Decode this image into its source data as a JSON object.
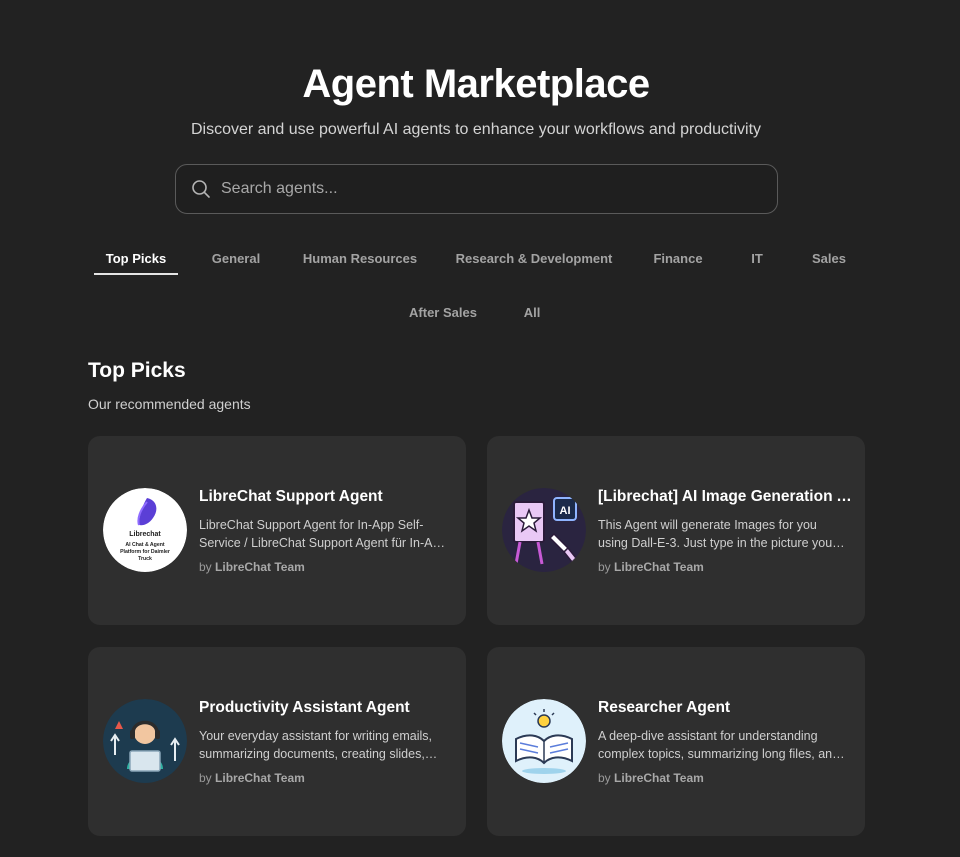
{
  "header": {
    "title": "Agent Marketplace",
    "subtitle": "Discover and use powerful AI agents to enhance your workflows and productivity"
  },
  "search": {
    "placeholder": "Search agents...",
    "value": ""
  },
  "tabs": [
    {
      "label": "Top Picks",
      "active": true
    },
    {
      "label": "General"
    },
    {
      "label": "Human Resources"
    },
    {
      "label": "Research & Development"
    },
    {
      "label": "Finance"
    },
    {
      "label": "IT"
    },
    {
      "label": "Sales"
    },
    {
      "label": "After Sales"
    },
    {
      "label": "All"
    }
  ],
  "section": {
    "title": "Top Picks",
    "subtitle": "Our recommended agents"
  },
  "agents": [
    {
      "name": "LibreChat Support Agent",
      "description": "LibreChat Support Agent for In-App Self-Service / LibreChat Support Agent für In-App Self-Service",
      "by_prefix": "by",
      "author": "LibreChat Team",
      "avatar_icon": "librechat-logo-icon",
      "avatar_text": [
        "Librechat",
        "AI Chat & Agent",
        "Platform for Daimler",
        "Truck"
      ]
    },
    {
      "name": "[Librechat] AI Image Generation Agent",
      "description": "This Agent will generate Images for you using Dall-E-3. Just type in the picture you want to see.",
      "by_prefix": "by",
      "author": "LibreChat Team",
      "avatar_icon": "image-generation-icon",
      "avatar_text": [
        "AI"
      ]
    },
    {
      "name": "Productivity Assistant Agent",
      "description": "Your everyday assistant for writing emails, summarizing documents, creating slides, and more.",
      "by_prefix": "by",
      "author": "LibreChat Team",
      "avatar_icon": "headset-assistant-icon"
    },
    {
      "name": "Researcher Agent",
      "description": "A deep-dive assistant for understanding complex topics, summarizing long files, and more.",
      "by_prefix": "by",
      "author": "LibreChat Team",
      "avatar_icon": "open-book-icon"
    }
  ],
  "colors": {
    "background": "#222222",
    "card": "#2f2f2f",
    "search_border": "#5a5a5a",
    "active_tab": "#ffffff",
    "inactive_tab": "#a3a3a3"
  }
}
